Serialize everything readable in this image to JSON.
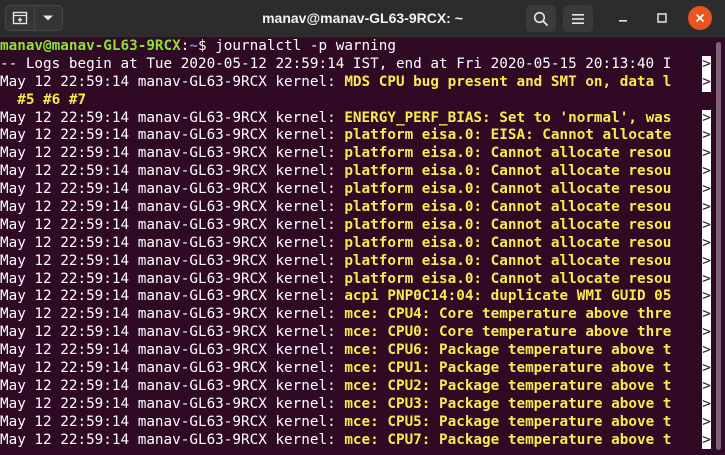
{
  "window": {
    "title": "manav@manav-GL63-9RCX: ~"
  },
  "prompt": {
    "user_host": "manav@manav-GL63-9RCX",
    "sep": ":",
    "path": "~",
    "symbol": "$",
    "command": "journalctl -p warning"
  },
  "log_header": "-- Logs begin at Tue 2020-05-12 22:59:14 IST, end at Fri 2020-05-15 20:13:40 I",
  "lines": [
    {
      "prefix": "May 12 22:59:14 manav-GL63-9RCX kernel: ",
      "message": "MDS CPU bug present and SMT on, data l",
      "trunc": true
    },
    {
      "prefix": "",
      "message": "  #5 #6 #7",
      "trunc": false
    },
    {
      "prefix": "May 12 22:59:14 manav-GL63-9RCX kernel: ",
      "message": "ENERGY_PERF_BIAS: Set to 'normal', was",
      "trunc": true
    },
    {
      "prefix": "May 12 22:59:14 manav-GL63-9RCX kernel: ",
      "message": "platform eisa.0: EISA: Cannot allocate",
      "trunc": true
    },
    {
      "prefix": "May 12 22:59:14 manav-GL63-9RCX kernel: ",
      "message": "platform eisa.0: Cannot allocate resou",
      "trunc": true
    },
    {
      "prefix": "May 12 22:59:14 manav-GL63-9RCX kernel: ",
      "message": "platform eisa.0: Cannot allocate resou",
      "trunc": true
    },
    {
      "prefix": "May 12 22:59:14 manav-GL63-9RCX kernel: ",
      "message": "platform eisa.0: Cannot allocate resou",
      "trunc": true
    },
    {
      "prefix": "May 12 22:59:14 manav-GL63-9RCX kernel: ",
      "message": "platform eisa.0: Cannot allocate resou",
      "trunc": true
    },
    {
      "prefix": "May 12 22:59:14 manav-GL63-9RCX kernel: ",
      "message": "platform eisa.0: Cannot allocate resou",
      "trunc": true
    },
    {
      "prefix": "May 12 22:59:14 manav-GL63-9RCX kernel: ",
      "message": "platform eisa.0: Cannot allocate resou",
      "trunc": true
    },
    {
      "prefix": "May 12 22:59:14 manav-GL63-9RCX kernel: ",
      "message": "platform eisa.0: Cannot allocate resou",
      "trunc": true
    },
    {
      "prefix": "May 12 22:59:14 manav-GL63-9RCX kernel: ",
      "message": "platform eisa.0: Cannot allocate resou",
      "trunc": true
    },
    {
      "prefix": "May 12 22:59:14 manav-GL63-9RCX kernel: ",
      "message": "acpi PNP0C14:04: duplicate WMI GUID 05",
      "trunc": true
    },
    {
      "prefix": "May 12 22:59:14 manav-GL63-9RCX kernel: ",
      "message": "mce: CPU4: Core temperature above thre",
      "trunc": true
    },
    {
      "prefix": "May 12 22:59:14 manav-GL63-9RCX kernel: ",
      "message": "mce: CPU0: Core temperature above thre",
      "trunc": true
    },
    {
      "prefix": "May 12 22:59:14 manav-GL63-9RCX kernel: ",
      "message": "mce: CPU6: Package temperature above t",
      "trunc": true
    },
    {
      "prefix": "May 12 22:59:14 manav-GL63-9RCX kernel: ",
      "message": "mce: CPU1: Package temperature above t",
      "trunc": true
    },
    {
      "prefix": "May 12 22:59:14 manav-GL63-9RCX kernel: ",
      "message": "mce: CPU2: Package temperature above t",
      "trunc": true
    },
    {
      "prefix": "May 12 22:59:14 manav-GL63-9RCX kernel: ",
      "message": "mce: CPU3: Package temperature above t",
      "trunc": true
    },
    {
      "prefix": "May 12 22:59:14 manav-GL63-9RCX kernel: ",
      "message": "mce: CPU5: Package temperature above t",
      "trunc": true
    },
    {
      "prefix": "May 12 22:59:14 manav-GL63-9RCX kernel: ",
      "message": "mce: CPU7: Package temperature above t",
      "trunc": true
    }
  ],
  "truncation_marker": ">",
  "colors": {
    "background": "#300a24",
    "titlebar": "#2c2c2c",
    "prompt_user": "#8ae234",
    "prompt_path": "#729fcf",
    "warning_text": "#fce94f",
    "close_button": "#e95420"
  },
  "icons": {
    "new_tab": "new-tab-icon",
    "dropdown": "chevron-down-icon",
    "search": "search-icon",
    "menu": "hamburger-menu-icon",
    "minimize": "minimize-icon",
    "maximize": "maximize-icon",
    "close": "close-icon"
  }
}
